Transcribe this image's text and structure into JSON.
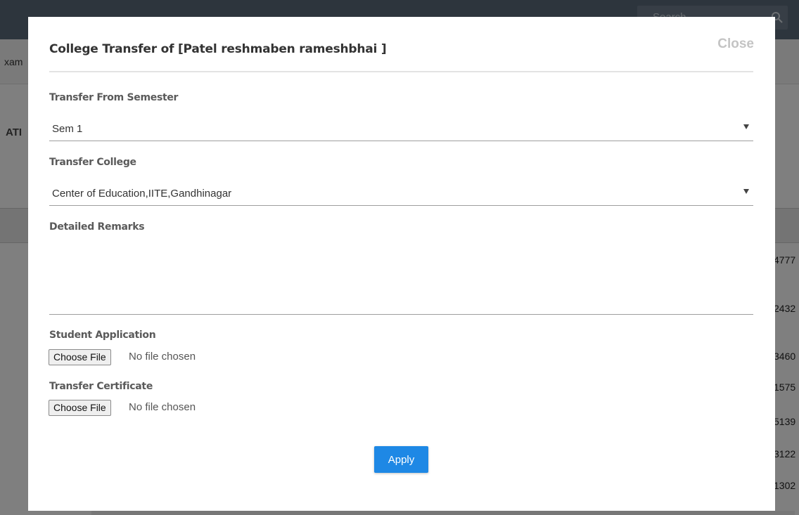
{
  "background": {
    "search": {
      "placeholder": "Search"
    },
    "menu_fragment": "xam",
    "heading_fragment": "ATI",
    "column_values": [
      "4777",
      "2432",
      "3460",
      "1575",
      "5139",
      "3122",
      "1302"
    ]
  },
  "modal": {
    "title": "College Transfer of [Patel reshmaben rameshbhai ]",
    "close_label": "Close",
    "semester": {
      "label": "Transfer From Semester",
      "value": "Sem 1"
    },
    "college": {
      "label": "Transfer College",
      "value": "Center of Education,IITE,Gandhinagar"
    },
    "remarks": {
      "label": "Detailed Remarks",
      "value": ""
    },
    "student_application": {
      "label": "Student Application",
      "button_label": "Choose File",
      "status": "No file chosen"
    },
    "transfer_certificate": {
      "label": "Transfer Certificate",
      "button_label": "Choose File",
      "status": "No file chosen"
    },
    "apply_label": "Apply"
  },
  "colors": {
    "primary": "#1e88e5",
    "overlay": "rgba(0,0,0,0.5)",
    "close": "#c4c4c4",
    "label": "#5a5a5a"
  },
  "icons": {
    "search": "search-icon",
    "dropdown": "caret-down-icon"
  }
}
